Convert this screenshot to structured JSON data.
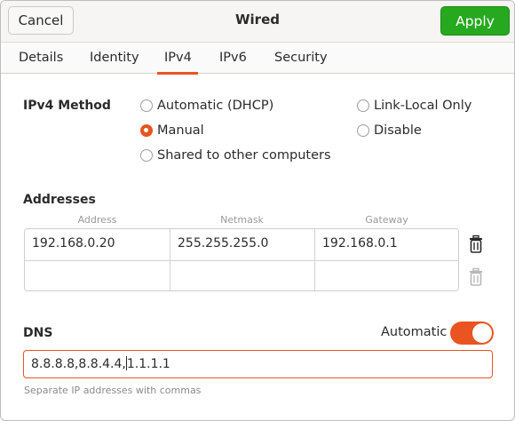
{
  "header": {
    "cancel_label": "Cancel",
    "title": "Wired",
    "apply_label": "Apply"
  },
  "tabs": [
    {
      "label": "Details",
      "active": false
    },
    {
      "label": "Identity",
      "active": false
    },
    {
      "label": "IPv4",
      "active": true
    },
    {
      "label": "IPv6",
      "active": false
    },
    {
      "label": "Security",
      "active": false
    }
  ],
  "ipv4_method": {
    "label": "IPv4 Method",
    "options": [
      {
        "label": "Automatic (DHCP)",
        "checked": false
      },
      {
        "label": "Link-Local Only",
        "checked": false
      },
      {
        "label": "Manual",
        "checked": true
      },
      {
        "label": "Disable",
        "checked": false
      },
      {
        "label": "Shared to other computers",
        "checked": false
      }
    ]
  },
  "addresses": {
    "label": "Addresses",
    "columns": [
      "Address",
      "Netmask",
      "Gateway"
    ],
    "rows": [
      {
        "address": "192.168.0.20",
        "netmask": "255.255.255.0",
        "gateway": "192.168.0.1"
      },
      {
        "address": "",
        "netmask": "",
        "gateway": ""
      }
    ]
  },
  "dns": {
    "label": "DNS",
    "automatic_label": "Automatic",
    "automatic_on": true,
    "value_before_cursor": "8.8.8.8,8.8.4.4,",
    "value_after_cursor": "1.1.1.1",
    "hint": "Separate IP addresses with commas"
  },
  "colors": {
    "accent": "#e95420",
    "apply_green": "#26a91f"
  },
  "icons": {
    "delete_row": "trash-icon"
  }
}
